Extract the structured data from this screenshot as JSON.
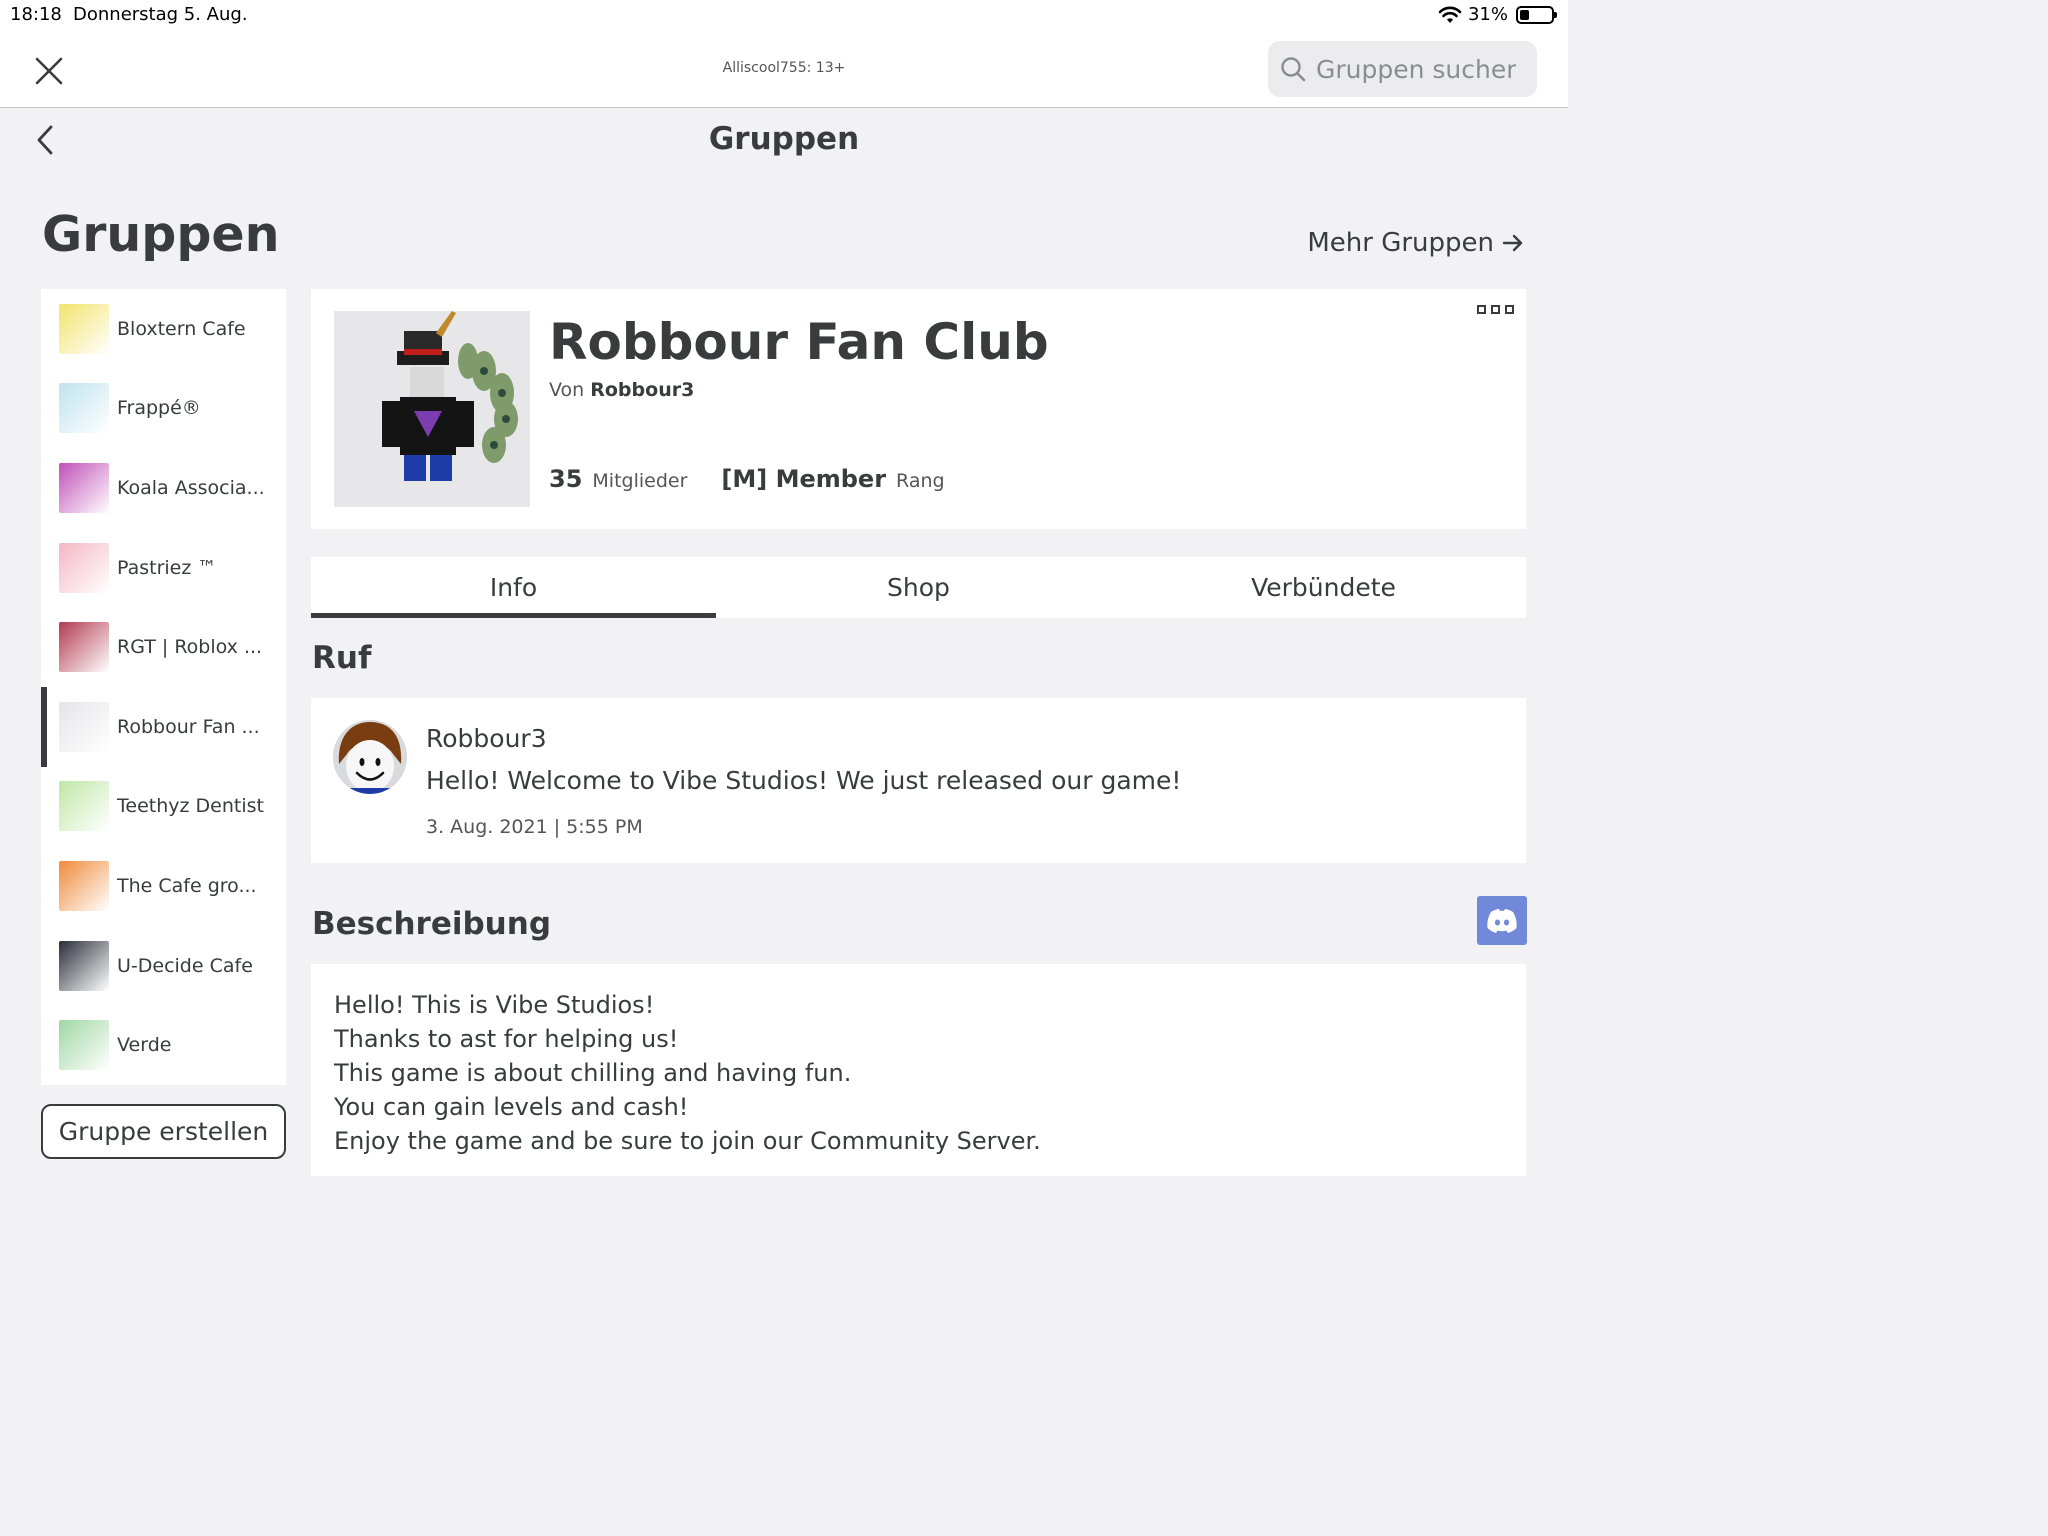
{
  "status_bar": {
    "time": "18:18",
    "date": "Donnerstag 5. Aug.",
    "battery": "31%",
    "battery_level": 0.31
  },
  "top_bar": {
    "account_label": "Alliscool755: 13+",
    "search_placeholder": "Gruppen suchen"
  },
  "nav": {
    "title": "Gruppen"
  },
  "page": {
    "heading": "Gruppen",
    "more_groups_label": "Mehr Gruppen"
  },
  "sidebar": {
    "items": [
      {
        "label": "Bloxtern Cafe",
        "thumb_color": "#f3e36b"
      },
      {
        "label": "Frappé®",
        "thumb_color": "#bfe3ee"
      },
      {
        "label": "Koala Associa...",
        "thumb_color": "#c14fb8"
      },
      {
        "label": "Pastriez ™",
        "thumb_color": "#f4b6c4"
      },
      {
        "label": "RGT | Roblox ...",
        "thumb_color": "#b33a52"
      },
      {
        "label": "Robbour Fan ...",
        "thumb_color": "#e5e5e8",
        "active": true
      },
      {
        "label": "Teethyz Dentist",
        "thumb_color": "#bfe7a6"
      },
      {
        "label": "The Cafe gro...",
        "thumb_color": "#f08a3a"
      },
      {
        "label": "U-Decide Cafe",
        "thumb_color": "#2a2e3a"
      },
      {
        "label": "Verde",
        "thumb_color": "#9fd7a2"
      }
    ],
    "create_button": "Gruppe erstellen"
  },
  "group": {
    "name": "Robbour Fan Club",
    "owner_prefix": "Von",
    "owner": "Robbour3",
    "member_count": "35",
    "member_label": "Mitglieder",
    "rank": "[M] Member",
    "rank_label": "Rang"
  },
  "tabs": [
    {
      "label": "Info",
      "active": true
    },
    {
      "label": "Shop"
    },
    {
      "label": "Verbündete"
    }
  ],
  "shout": {
    "section_title": "Ruf",
    "author": "Robbour3",
    "text": "Hello! Welcome to Vibe Studios! We just released our game!",
    "date": "3. Aug. 2021 | 5:55 PM"
  },
  "description": {
    "section_title": "Beschreibung",
    "lines": [
      "Hello! This is Vibe Studios!",
      "Thanks to ast for helping us!",
      "This game is about chilling and having fun.",
      "You can gain levels and cash!",
      "Enjoy the game and be sure to join our Community Server."
    ]
  },
  "colors": {
    "text": "#393b3d",
    "background": "#f2f2f5",
    "discord": "#7289da"
  }
}
